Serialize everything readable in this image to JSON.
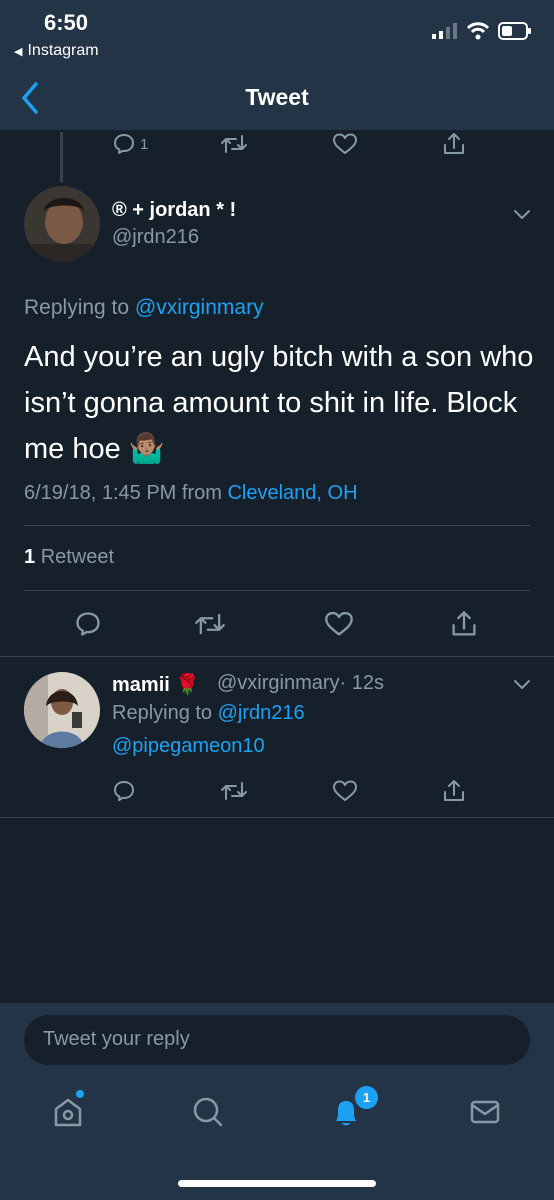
{
  "status_bar": {
    "time": "6:50",
    "back_app": "Instagram"
  },
  "nav": {
    "title": "Tweet"
  },
  "parent_tweet": {
    "reply_count": "1"
  },
  "main_tweet": {
    "display_name": "® + jordan * !",
    "handle": "@jrdn216",
    "replying_prefix": "Replying to",
    "replying_to": "@vxirginmary",
    "text": "And you’re an ugly bitch with a son who isn’t gonna amount to shit in life. Block me hoe 🤷🏽‍♂️",
    "timestamp": "6/19/18, 1:45 PM from",
    "location": "Cleveland, OH",
    "retweet_count": "1",
    "retweet_label": "Retweet"
  },
  "reply_tweet": {
    "display_name": "mamii 🌹",
    "handle": "@vxirginmary",
    "time": "· 12s",
    "replying_prefix": "Replying to",
    "replying_to": "@jrdn216",
    "text": "@pipegameon10"
  },
  "composer": {
    "placeholder": "Tweet your reply"
  },
  "tab_bar": {
    "items": [
      "home-icon",
      "search-icon",
      "notifications-icon",
      "messages-icon"
    ],
    "notification_badge": "1"
  },
  "colors": {
    "background": "#15202b",
    "panel": "#243447",
    "accent": "#1da1f2",
    "secondary_text": "#8899a6"
  }
}
